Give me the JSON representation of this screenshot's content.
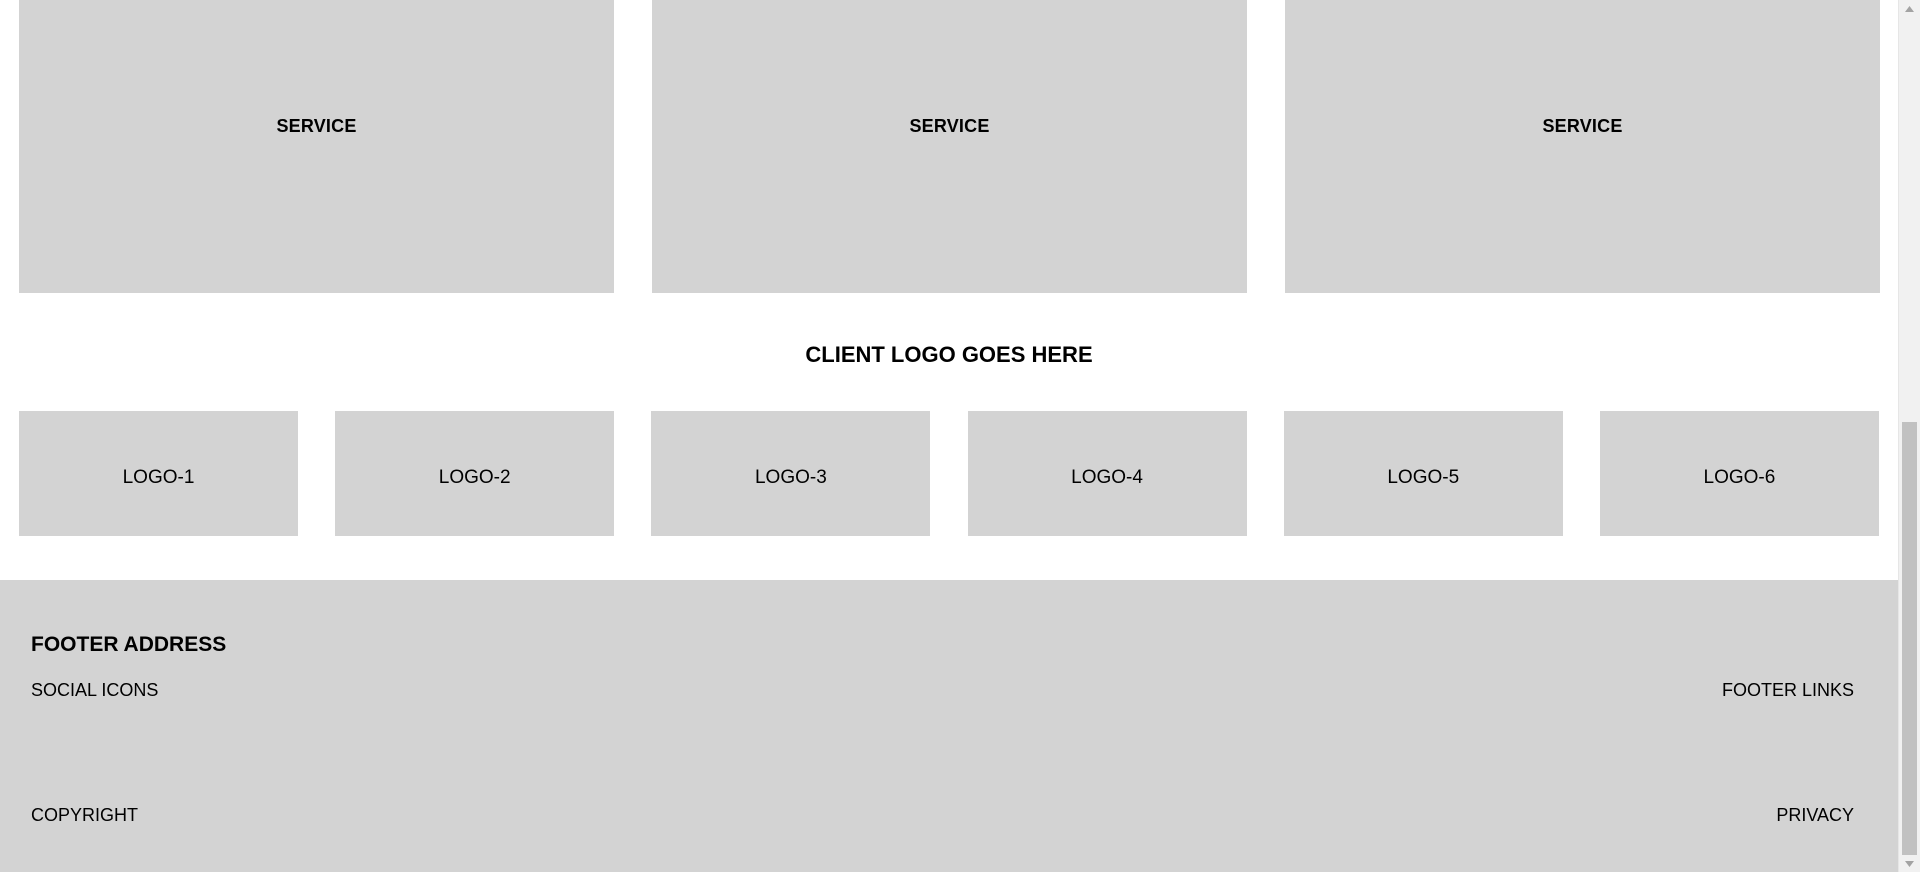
{
  "services": [
    {
      "label": "SERVICE"
    },
    {
      "label": "SERVICE"
    },
    {
      "label": "SERVICE"
    }
  ],
  "clients": {
    "title": "CLIENT LOGO GOES HERE",
    "logos": [
      {
        "label": "LOGO-1"
      },
      {
        "label": "LOGO-2"
      },
      {
        "label": "LOGO-3"
      },
      {
        "label": "LOGO-4"
      },
      {
        "label": "LOGO-5"
      },
      {
        "label": "LOGO-6"
      }
    ]
  },
  "footer": {
    "address": "FOOTER ADDRESS",
    "social_icons": "SOCIAL ICONS",
    "links": "FOOTER LINKS",
    "copyright": "COPYRIGHT",
    "privacy": "PRIVACY"
  },
  "colors": {
    "placeholder_gray": "#d3d3d3",
    "background": "#ffffff",
    "text": "#000000"
  },
  "scrollbar": {
    "up_icon": "arrow-up-icon",
    "down_icon": "arrow-down-icon"
  }
}
